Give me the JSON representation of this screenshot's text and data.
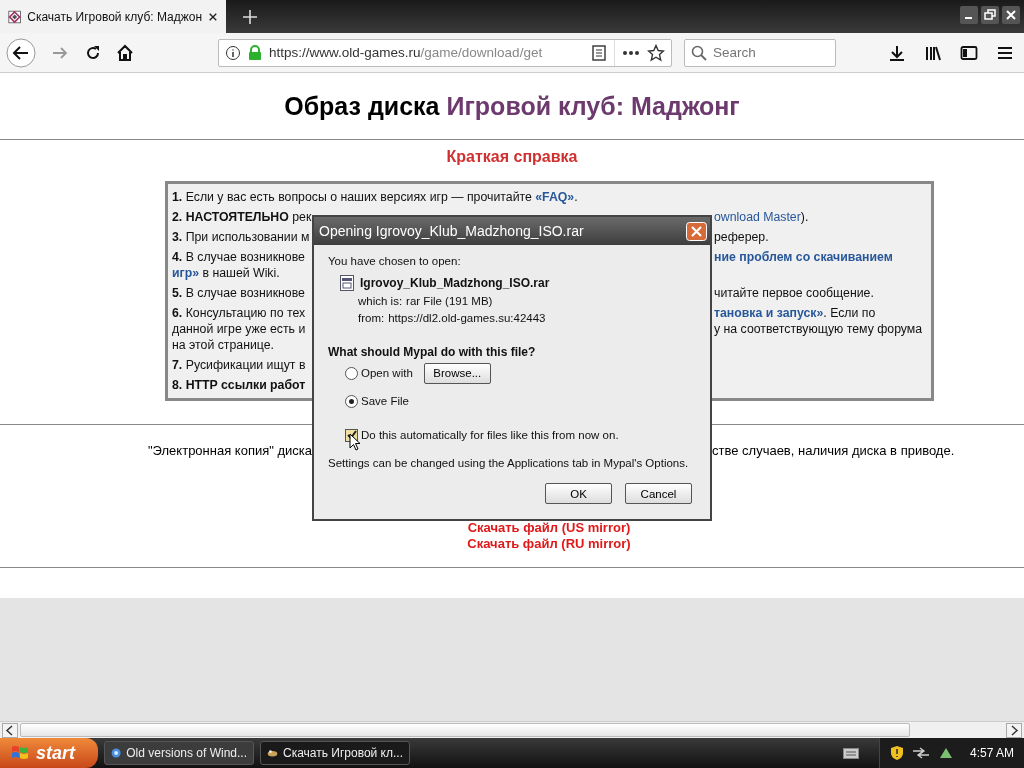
{
  "browser": {
    "tabs": [
      {
        "title": "Скачать Игровой клуб: Маджон",
        "selected": true
      }
    ],
    "url_host": "https://www.old-games.ru",
    "url_path": "/game/download/get",
    "search": {
      "placeholder": "Search"
    }
  },
  "page": {
    "title_plain": "Образ диска ",
    "title_accent": "Игровой клуб: Маджонг",
    "subtitle": "Краткая справка",
    "help_items": [
      {
        "lines": [
          {
            "left": [
              {
                "text": "1.",
                "kind": "bold"
              },
              {
                "text": " Если у вас есть вопросы о наших версиях игр — прочитайте ",
                "kind": "plain"
              },
              {
                "text": "«FAQ»",
                "kind": "link"
              },
              {
                "text": ".",
                "kind": "plain"
              }
            ]
          }
        ]
      },
      {
        "lines": [
          {
            "left": [
              {
                "text": "2.",
                "kind": "bold"
              },
              {
                "text": " НАСТОЯТЕЛЬНО",
                "kind": "bold"
              },
              {
                "text": " рек",
                "kind": "plain"
              }
            ],
            "right": [
              {
                "text": "ownload Master",
                "kind": "linkplain"
              },
              {
                "text": ").",
                "kind": "plain"
              }
            ]
          }
        ]
      },
      {
        "lines": [
          {
            "left": [
              {
                "text": "3.",
                "kind": "bold"
              },
              {
                "text": " При использовании м",
                "kind": "plain"
              }
            ],
            "right": [
              {
                "text": "реферер.",
                "kind": "plain"
              }
            ]
          }
        ]
      },
      {
        "lines": [
          {
            "left": [
              {
                "text": "4.",
                "kind": "bold"
              },
              {
                "text": " В случае возникнове",
                "kind": "plain"
              }
            ],
            "right": [
              {
                "text": "ние проблем со скачиванием",
                "kind": "link"
              }
            ]
          },
          {
            "left": [
              {
                "text": "игр»",
                "kind": "link"
              },
              {
                "text": " в нашей Wiki.",
                "kind": "plain"
              }
            ]
          }
        ]
      },
      {
        "lines": [
          {
            "left": [
              {
                "text": "5.",
                "kind": "bold"
              },
              {
                "text": " В случае возникнове",
                "kind": "plain"
              }
            ],
            "right": [
              {
                "text": "читайте первое сообщение.",
                "kind": "plain"
              }
            ]
          }
        ]
      },
      {
        "lines": [
          {
            "left": [
              {
                "text": "6.",
                "kind": "bold"
              },
              {
                "text": " Консультацию по тех",
                "kind": "plain"
              }
            ],
            "right": [
              {
                "text": "тановка и запуск»",
                "kind": "link"
              },
              {
                "text": ". Если по",
                "kind": "plain"
              }
            ]
          },
          {
            "left": [
              {
                "text": "данной игре уже есть и",
                "kind": "plain"
              }
            ],
            "right": [
              {
                "text": "у на соответствующую тему форума",
                "kind": "plain"
              }
            ]
          },
          {
            "left": [
              {
                "text": "на этой странице.",
                "kind": "plain"
              }
            ]
          }
        ]
      },
      {
        "lines": [
          {
            "left": [
              {
                "text": "7.",
                "kind": "bold"
              },
              {
                "text": " Русификации ищут в",
                "kind": "plain"
              }
            ]
          }
        ]
      },
      {
        "lines": [
          {
            "left": [
              {
                "text": "8.",
                "kind": "bold"
              },
              {
                "text": " HTTP ссылки работ",
                "kind": "bold"
              }
            ]
          }
        ]
      }
    ],
    "note_left": "\"Электронная копия\" диска",
    "note_right": "стве случаев, наличия диска в приводе.",
    "download_links": [
      "Скачать файл (US mirror)",
      "Скачать файл (RU mirror)"
    ]
  },
  "dialog": {
    "title": "Opening Igrovoy_Klub_Madzhong_ISO.rar",
    "intro": "You have chosen to open:",
    "file_name": "Igrovoy_Klub_Madzhong_ISO.rar",
    "which_label": "which is:",
    "which_value": "rar File (191 MB)",
    "from_label": "from:",
    "from_value": "https://dl2.old-games.su:42443",
    "question": "What should Mypal do with this file?",
    "options": [
      {
        "label": "Open with",
        "selected": false,
        "button": "Browse..."
      },
      {
        "label": "Save File",
        "selected": true
      }
    ],
    "auto": {
      "label": "Do this automatically for files like this from now on.",
      "checked": true
    },
    "hint": "Settings can be changed using the Applications tab in Mypal's Options.",
    "buttons": [
      "OK",
      "Cancel"
    ]
  },
  "taskbar": {
    "start": "start",
    "items": [
      {
        "label": "Old versions of Wind...",
        "selected": false
      },
      {
        "label": "Скачать Игровой кл...",
        "selected": true
      }
    ],
    "clock": "4:57 AM"
  }
}
